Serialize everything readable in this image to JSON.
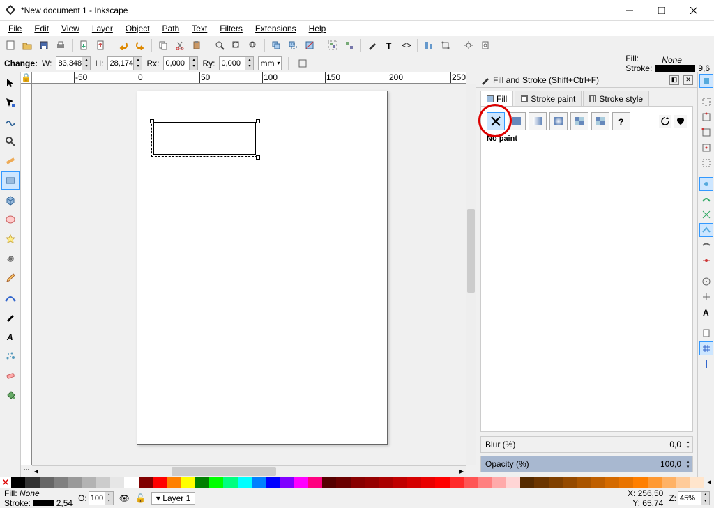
{
  "window": {
    "title": "*New document 1 - Inkscape"
  },
  "menu": {
    "file": "File",
    "edit": "Edit",
    "view": "View",
    "layer": "Layer",
    "object": "Object",
    "path": "Path",
    "text": "Text",
    "filters": "Filters",
    "extensions": "Extensions",
    "help": "Help"
  },
  "optsbar": {
    "change": "Change:",
    "w_label": "W:",
    "w": "83,348",
    "h_label": "H:",
    "h": "28,174",
    "rx_label": "Rx:",
    "rx": "0,000",
    "ry_label": "Ry:",
    "ry": "0,000",
    "unit": "mm"
  },
  "fsc": {
    "fill_label": "Fill:",
    "fill_value": "None",
    "stroke_label": "Stroke:",
    "stroke_value": "9,6"
  },
  "panel": {
    "title": "Fill and Stroke (Shift+Ctrl+F)",
    "tabs": {
      "fill": "Fill",
      "strokepaint": "Stroke paint",
      "strokestyle": "Stroke style"
    },
    "nopaint": "No paint",
    "blur_label": "Blur (%)",
    "blur_val": "0,0",
    "opacity_label": "Opacity (%)",
    "opacity_val": "100,0"
  },
  "status": {
    "fill_label": "Fill:",
    "fill_value": "None",
    "stroke_label": "Stroke:",
    "stroke_value": "2,54",
    "o_label": "O:",
    "o_val": "100",
    "layer": "Layer 1",
    "x_label": "X:",
    "x_val": "256,50",
    "y_label": "Y:",
    "y_val": "65,74",
    "z_label": "Z:",
    "z_val": "45%"
  },
  "ruler": {
    "marks": [
      "-50",
      "0",
      "50",
      "100",
      "150",
      "200",
      "250"
    ]
  },
  "palette_colors": [
    "#000",
    "#333",
    "#666",
    "#808080",
    "#999",
    "#b3b3b3",
    "#ccc",
    "#e6e6e6",
    "#fff",
    "#800000",
    "#f00",
    "#ff8000",
    "#ff0",
    "#008000",
    "#0f0",
    "#00ff80",
    "#0ff",
    "#0080ff",
    "#00f",
    "#8000ff",
    "#f0f",
    "#ff0080",
    "#560000",
    "#6a0000",
    "#800",
    "#950000",
    "#aa0000",
    "#bf0000",
    "#d40000",
    "#e90000",
    "#f00",
    "#ff2a2a",
    "#ff5555",
    "#ff8080",
    "#faa",
    "#ffd5d5",
    "#562b00",
    "#6b3500",
    "#804000",
    "#954a00",
    "#aa5500",
    "#bf5f00",
    "#d46a00",
    "#e97400",
    "#ff7f00",
    "#ff9932",
    "#ffb265",
    "#ffcb99",
    "#ffe5cc"
  ]
}
